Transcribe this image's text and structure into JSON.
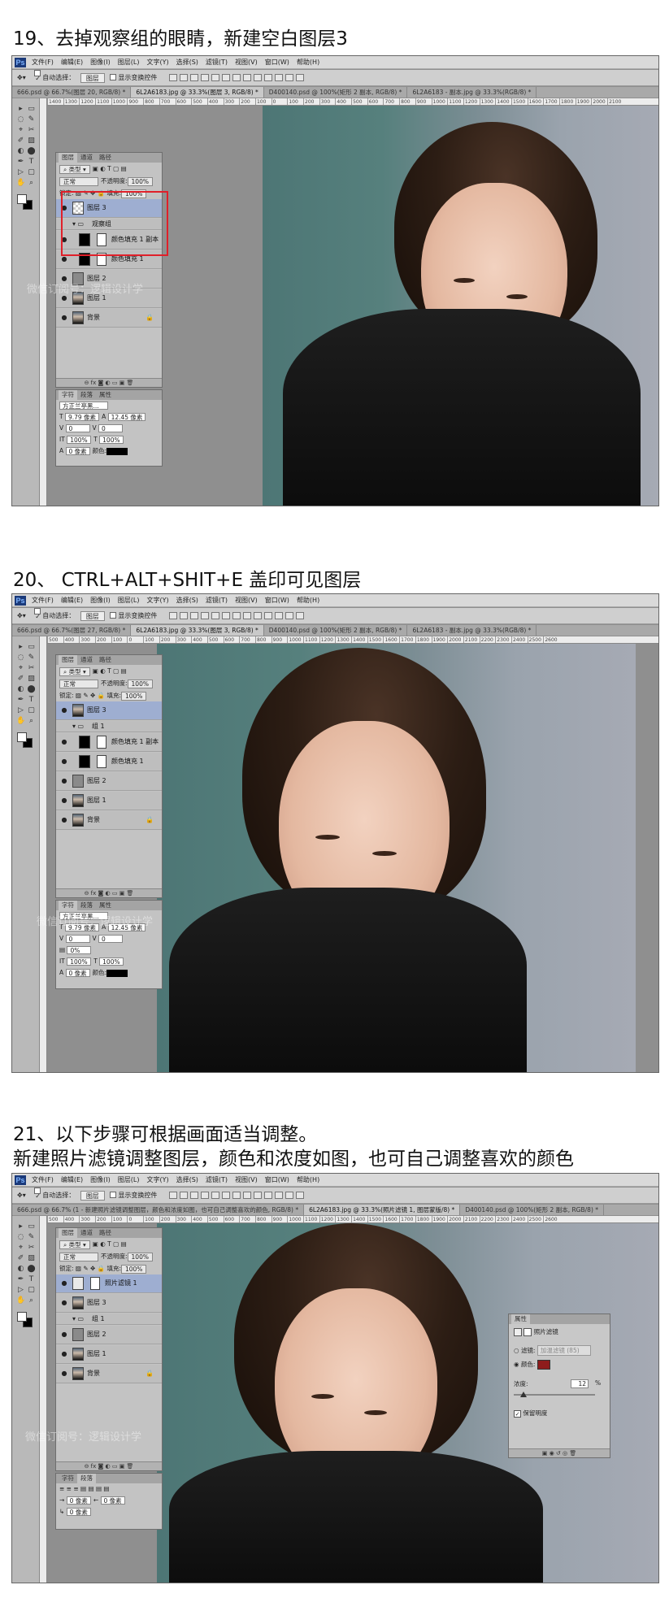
{
  "steps": [
    {
      "title": "19、去掉观察组的眼睛，新建空白图层3",
      "menus": [
        "文件(F)",
        "编辑(E)",
        "图像(I)",
        "图层(L)",
        "文字(Y)",
        "选择(S)",
        "滤镜(T)",
        "视图(V)",
        "窗口(W)",
        "帮助(H)"
      ],
      "options": {
        "auto_select": "自动选择：",
        "select_value": "图层",
        "transform": "显示变换控件"
      },
      "tabs": [
        "666.psd @ 66.7%(图层 20, RGB/8) *",
        "6L2A6183.jpg @ 33.3%(图层 3, RGB/8) *",
        "D400140.psd @ 100%(矩形 2 副本, RGB/8) *",
        "6L2A6183 - 副本.jpg @ 33.3%(RGB/8) *"
      ],
      "ruler": [
        "1400",
        "1300",
        "1200",
        "1100",
        "1000",
        "900",
        "800",
        "700",
        "600",
        "500",
        "400",
        "300",
        "200",
        "100",
        "0",
        "100",
        "200",
        "300",
        "400",
        "500",
        "600",
        "700",
        "800",
        "900",
        "1000",
        "1100",
        "1200",
        "1300",
        "1400",
        "1500",
        "1600",
        "1700",
        "1800",
        "1900",
        "2000",
        "2100"
      ],
      "panel_tabs": [
        "图层",
        "通道",
        "路径"
      ],
      "kind": "类型",
      "blend": "正常",
      "opacity_label": "不透明度:",
      "opacity": "100%",
      "lock_label": "锁定:",
      "fill_label": "填充:",
      "fill": "100%",
      "layers": [
        {
          "name": "图层 3",
          "eye": "●",
          "thumb": "checker",
          "mask": false,
          "selected": true,
          "indent": 0
        },
        {
          "name": "观察组",
          "eye": "",
          "thumb": "group",
          "mask": false,
          "selected": false,
          "indent": 0
        },
        {
          "name": "颜色填充 1 副本",
          "eye": "●",
          "thumb": "blk",
          "mask": true,
          "selected": false,
          "indent": 1
        },
        {
          "name": "颜色填充 1",
          "eye": "●",
          "thumb": "blk",
          "mask": true,
          "selected": false,
          "indent": 1
        },
        {
          "name": "图层 2",
          "eye": "●",
          "thumb": "gray",
          "mask": false,
          "selected": false,
          "indent": 0
        },
        {
          "name": "图层 1",
          "eye": "●",
          "thumb": "photo",
          "mask": false,
          "selected": false,
          "indent": 0
        },
        {
          "name": "背景",
          "eye": "●",
          "thumb": "photo",
          "mask": false,
          "selected": false,
          "indent": 0,
          "lock": "🔒"
        }
      ],
      "char_tabs": [
        "字符",
        "段落",
        "属性"
      ],
      "font": "方正兰亭黑...",
      "font_size": "9.79 像素",
      "leading": "12.45 像素",
      "tracking": "0",
      "kerning": "0",
      "scale_v": "100%",
      "scale_h": "100%",
      "baseline": "0 像素",
      "color_label": "颜色:",
      "percent_zero": "0%",
      "watermark": "微信订阅号：逻辑设计学"
    },
    {
      "title": "20、 CTRL+ALT+SHIT+E 盖印可见图层",
      "menus": [
        "文件(F)",
        "编辑(E)",
        "图像(I)",
        "图层(L)",
        "文字(Y)",
        "选择(S)",
        "滤镜(T)",
        "视图(V)",
        "窗口(W)",
        "帮助(H)"
      ],
      "options": {
        "auto_select": "自动选择：",
        "select_value": "图层",
        "transform": "显示变换控件"
      },
      "tabs": [
        "666.psd @ 66.7%(图层 27, RGB/8) *",
        "6L2A6183.jpg @ 33.3%(图层 3, RGB/8) *",
        "D400140.psd @ 100%(矩形 2 副本, RGB/8) *",
        "6L2A6183 - 副本.jpg @ 33.3%(RGB/8) *"
      ],
      "ruler": [
        "500",
        "400",
        "300",
        "200",
        "100",
        "0",
        "100",
        "200",
        "300",
        "400",
        "500",
        "600",
        "700",
        "800",
        "900",
        "1000",
        "1100",
        "1200",
        "1300",
        "1400",
        "1500",
        "1600",
        "1700",
        "1800",
        "1900",
        "2000",
        "2100",
        "2200",
        "2300",
        "2400",
        "2500",
        "2600"
      ],
      "panel_tabs": [
        "图层",
        "通道",
        "路径"
      ],
      "kind": "类型",
      "blend": "正常",
      "opacity_label": "不透明度:",
      "opacity": "100%",
      "lock_label": "锁定:",
      "fill_label": "填充:",
      "fill": "100%",
      "layers": [
        {
          "name": "图层 3",
          "eye": "●",
          "thumb": "photo",
          "mask": false,
          "selected": true,
          "indent": 0
        },
        {
          "name": "组 1",
          "eye": "",
          "thumb": "group",
          "mask": false,
          "selected": false,
          "indent": 0
        },
        {
          "name": "颜色填充 1 副本",
          "eye": "●",
          "thumb": "blk",
          "mask": true,
          "selected": false,
          "indent": 1
        },
        {
          "name": "颜色填充 1",
          "eye": "●",
          "thumb": "blk",
          "mask": true,
          "selected": false,
          "indent": 1
        },
        {
          "name": "图层 2",
          "eye": "●",
          "thumb": "gray",
          "mask": false,
          "selected": false,
          "indent": 0
        },
        {
          "name": "图层 1",
          "eye": "●",
          "thumb": "photo",
          "mask": false,
          "selected": false,
          "indent": 0
        },
        {
          "name": "背景",
          "eye": "●",
          "thumb": "photo",
          "mask": false,
          "selected": false,
          "indent": 0,
          "lock": "🔒"
        }
      ],
      "char_tabs": [
        "字符",
        "段落",
        "属性"
      ],
      "font": "方正兰亭黑...",
      "font_size": "9.79 像素",
      "leading": "12.45 像素",
      "tracking": "0",
      "kerning": "0",
      "scale_v": "100%",
      "scale_h": "100%",
      "baseline": "0 像素",
      "color_label": "颜色:",
      "percent_zero": "0%",
      "watermark": "微信订阅号：逻辑设计学"
    },
    {
      "title": "21、以下步骤可根据画面适当调整。",
      "title2": "新建照片滤镜调整图层，颜色和浓度如图，也可自己调整喜欢的颜色",
      "menus": [
        "文件(F)",
        "编辑(E)",
        "图像(I)",
        "图层(L)",
        "文字(Y)",
        "选择(S)",
        "滤镜(T)",
        "视图(V)",
        "窗口(W)",
        "帮助(H)"
      ],
      "options": {
        "auto_select": "自动选择：",
        "select_value": "图层",
        "transform": "显示变换控件"
      },
      "tabs": [
        "666.psd @ 66.7% (1 - 新建照片滤镜调整图层，颜色和浓度如图，也可自己调整喜欢的颜色, RGB/8) *",
        "6L2A6183.jpg @ 33.3%(照片滤镜 1, 图层蒙版/8) *",
        "D400140.psd @ 100%(矩形 2 副本, RGB/8) *"
      ],
      "ruler": [
        "500",
        "400",
        "300",
        "200",
        "100",
        "0",
        "100",
        "200",
        "300",
        "400",
        "500",
        "600",
        "700",
        "800",
        "900",
        "1000",
        "1100",
        "1200",
        "1300",
        "1400",
        "1500",
        "1600",
        "1700",
        "1800",
        "1900",
        "2000",
        "2100",
        "2200",
        "2300",
        "2400",
        "2500",
        "2600"
      ],
      "panel_tabs": [
        "图层",
        "通道",
        "路径"
      ],
      "kind": "类型",
      "blend": "正常",
      "opacity_label": "不透明度:",
      "opacity": "100%",
      "lock_label": "锁定:",
      "fill_label": "填充:",
      "fill": "100%",
      "layers": [
        {
          "name": "照片滤镜 1",
          "eye": "●",
          "thumb": "adjust",
          "mask": true,
          "selected": true,
          "indent": 0
        },
        {
          "name": "图层 3",
          "eye": "●",
          "thumb": "photo",
          "mask": false,
          "selected": false,
          "indent": 0
        },
        {
          "name": "组 1",
          "eye": "",
          "thumb": "group",
          "mask": false,
          "selected": false,
          "indent": 0
        },
        {
          "name": "图层 2",
          "eye": "●",
          "thumb": "gray",
          "mask": false,
          "selected": false,
          "indent": 0
        },
        {
          "name": "图层 1",
          "eye": "●",
          "thumb": "photo",
          "mask": false,
          "selected": false,
          "indent": 0
        },
        {
          "name": "背景",
          "eye": "●",
          "thumb": "photo",
          "mask": false,
          "selected": false,
          "indent": 0,
          "lock": "🔒"
        }
      ],
      "char_tabs": [
        "字符",
        "段落"
      ],
      "baseline": "0 像素",
      "baseline2": "0 像素",
      "baseline3": "0 像素",
      "watermark": "微信订阅号：逻辑设计学",
      "properties": {
        "tab": "属性",
        "title": "照片滤镜",
        "filter_label": "滤镜:",
        "filter_value": "加温滤镜 (85)",
        "color_label": "颜色:",
        "color": "#8e1c1c",
        "density_label": "浓度:",
        "density": "12",
        "density_unit": "%",
        "density_fraction": 0.12,
        "preserve_label": "保留明度"
      }
    }
  ]
}
